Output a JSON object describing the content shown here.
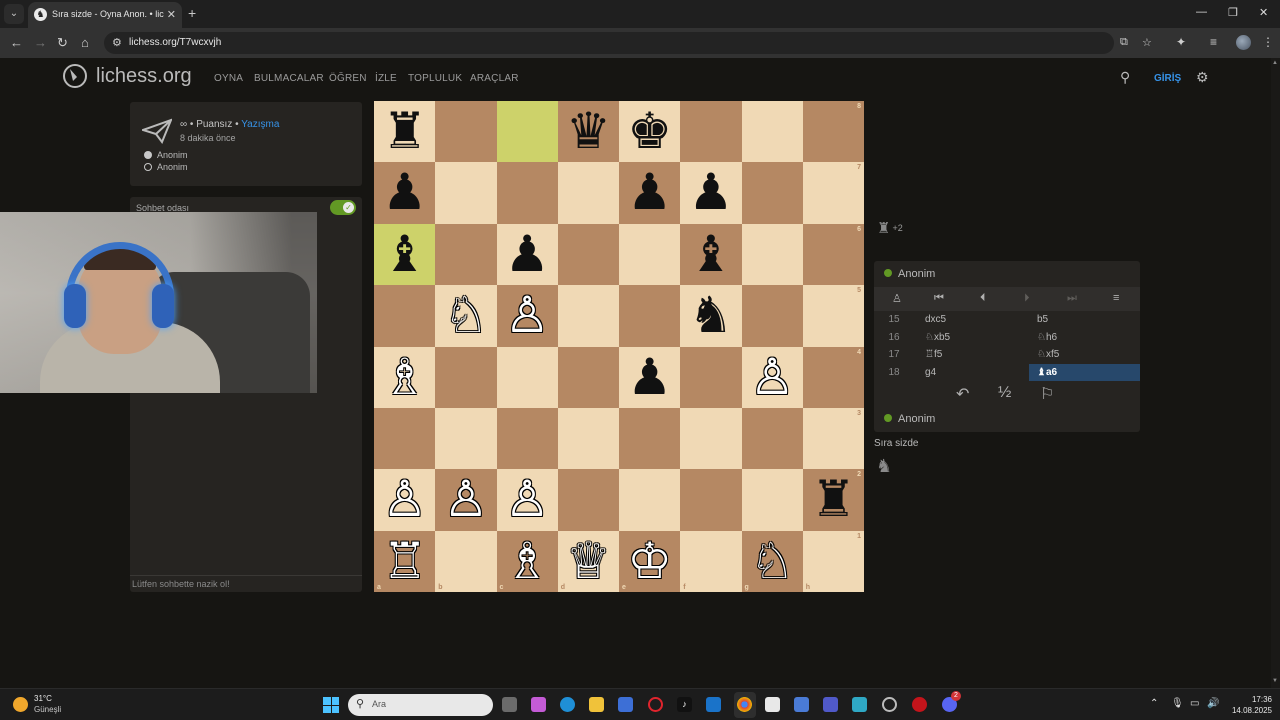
{
  "browser": {
    "tab_title": "Sıra sizde - Oyna Anon. • liches",
    "url": "lichess.org/T7wcxvjh"
  },
  "site": {
    "logo": "lichess.org",
    "menu": [
      "OYNA",
      "BULMACALAR",
      "ÖĞREN",
      "İZLE",
      "TOPLULUK",
      "ARAÇLAR"
    ],
    "login": "GİRİŞ"
  },
  "game_meta": {
    "time_control": "∞",
    "sep1": " • ",
    "rated": "Puansız",
    "sep2": " • ",
    "variant": "Yazışma",
    "when": "8 dakika önce",
    "player_white": "Anonim",
    "player_black": "Anonim"
  },
  "chat": {
    "title": "Sohbet odası",
    "enabled": true,
    "placeholder": "Lütfen sohbette nazik ol!"
  },
  "board": {
    "ranks": [
      "8",
      "7",
      "6",
      "5",
      "4",
      "3",
      "2",
      "1"
    ],
    "files": [
      "a",
      "b",
      "c",
      "d",
      "e",
      "f",
      "g",
      "h"
    ],
    "highlight": [
      "c8",
      "a6"
    ],
    "colors": {
      "light": "#f0d9b5",
      "dark": "#b58863",
      "hl_light": "#cdd26a",
      "hl_dark": "#aaa23a"
    },
    "pieces": [
      {
        "sq": "a8",
        "p": "♜",
        "c": "b"
      },
      {
        "sq": "d8",
        "p": "♛",
        "c": "b"
      },
      {
        "sq": "e8",
        "p": "♚",
        "c": "b"
      },
      {
        "sq": "a7",
        "p": "♟",
        "c": "b"
      },
      {
        "sq": "e7",
        "p": "♟",
        "c": "b"
      },
      {
        "sq": "f7",
        "p": "♟",
        "c": "b"
      },
      {
        "sq": "a6",
        "p": "♝",
        "c": "b"
      },
      {
        "sq": "c6",
        "p": "♟",
        "c": "b"
      },
      {
        "sq": "f6",
        "p": "♝",
        "c": "b"
      },
      {
        "sq": "b5",
        "p": "♘",
        "c": "w"
      },
      {
        "sq": "c5",
        "p": "♙",
        "c": "w"
      },
      {
        "sq": "f5",
        "p": "♞",
        "c": "b"
      },
      {
        "sq": "a4",
        "p": "♗",
        "c": "w"
      },
      {
        "sq": "e4",
        "p": "♟",
        "c": "b"
      },
      {
        "sq": "g4",
        "p": "♙",
        "c": "w"
      },
      {
        "sq": "a2",
        "p": "♙",
        "c": "w"
      },
      {
        "sq": "b2",
        "p": "♙",
        "c": "w"
      },
      {
        "sq": "c2",
        "p": "♙",
        "c": "w"
      },
      {
        "sq": "h2",
        "p": "♜",
        "c": "b"
      },
      {
        "sq": "a1",
        "p": "♖",
        "c": "w"
      },
      {
        "sq": "c1",
        "p": "♗",
        "c": "w"
      },
      {
        "sq": "d1",
        "p": "♕",
        "c": "w"
      },
      {
        "sq": "e1",
        "p": "♔",
        "c": "w"
      },
      {
        "sq": "g1",
        "p": "♘",
        "c": "w"
      }
    ]
  },
  "material": {
    "piece": "♜",
    "diff": "+2"
  },
  "panel": {
    "top_player": "Anonim",
    "bottom_player": "Anonim",
    "moves": [
      {
        "n": "15",
        "w": "dxc5",
        "b": "b5"
      },
      {
        "n": "16",
        "w": "♘xb5",
        "b": "♘h6"
      },
      {
        "n": "17",
        "w": "♖f5",
        "b": "♘xf5"
      },
      {
        "n": "18",
        "w": "g4",
        "b": "♝a6"
      }
    ],
    "active_move": "♝a6",
    "draw_label": "½",
    "turn_text": "Sıra sizde",
    "turn_piece": "♞"
  },
  "taskbar": {
    "temp": "31°C",
    "condition": "Güneşli",
    "search_placeholder": "Ara",
    "time": "17:36",
    "date": "14.08.2025",
    "badge": "2"
  }
}
